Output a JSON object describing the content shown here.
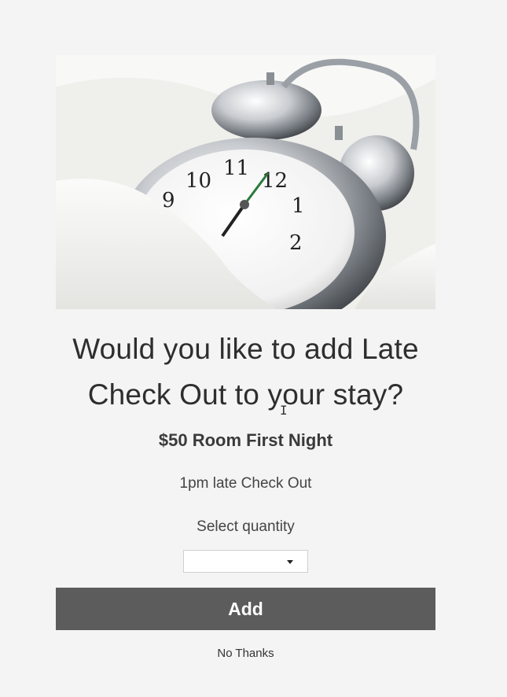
{
  "hero": {
    "image": "alarm-clock-in-bed-photo"
  },
  "offer": {
    "headline_line1": "Would you like to add Late",
    "headline_line2": "Check Out to your stay?",
    "title": "$50 Room First Night",
    "description": "1pm late Check Out"
  },
  "quantity": {
    "label": "Select quantity",
    "selected": ""
  },
  "actions": {
    "add_label": "Add",
    "decline_label": "No Thanks"
  },
  "colors": {
    "page_background": "#f4f4f4",
    "button_background": "#5c5c5c",
    "button_text": "#ffffff"
  }
}
